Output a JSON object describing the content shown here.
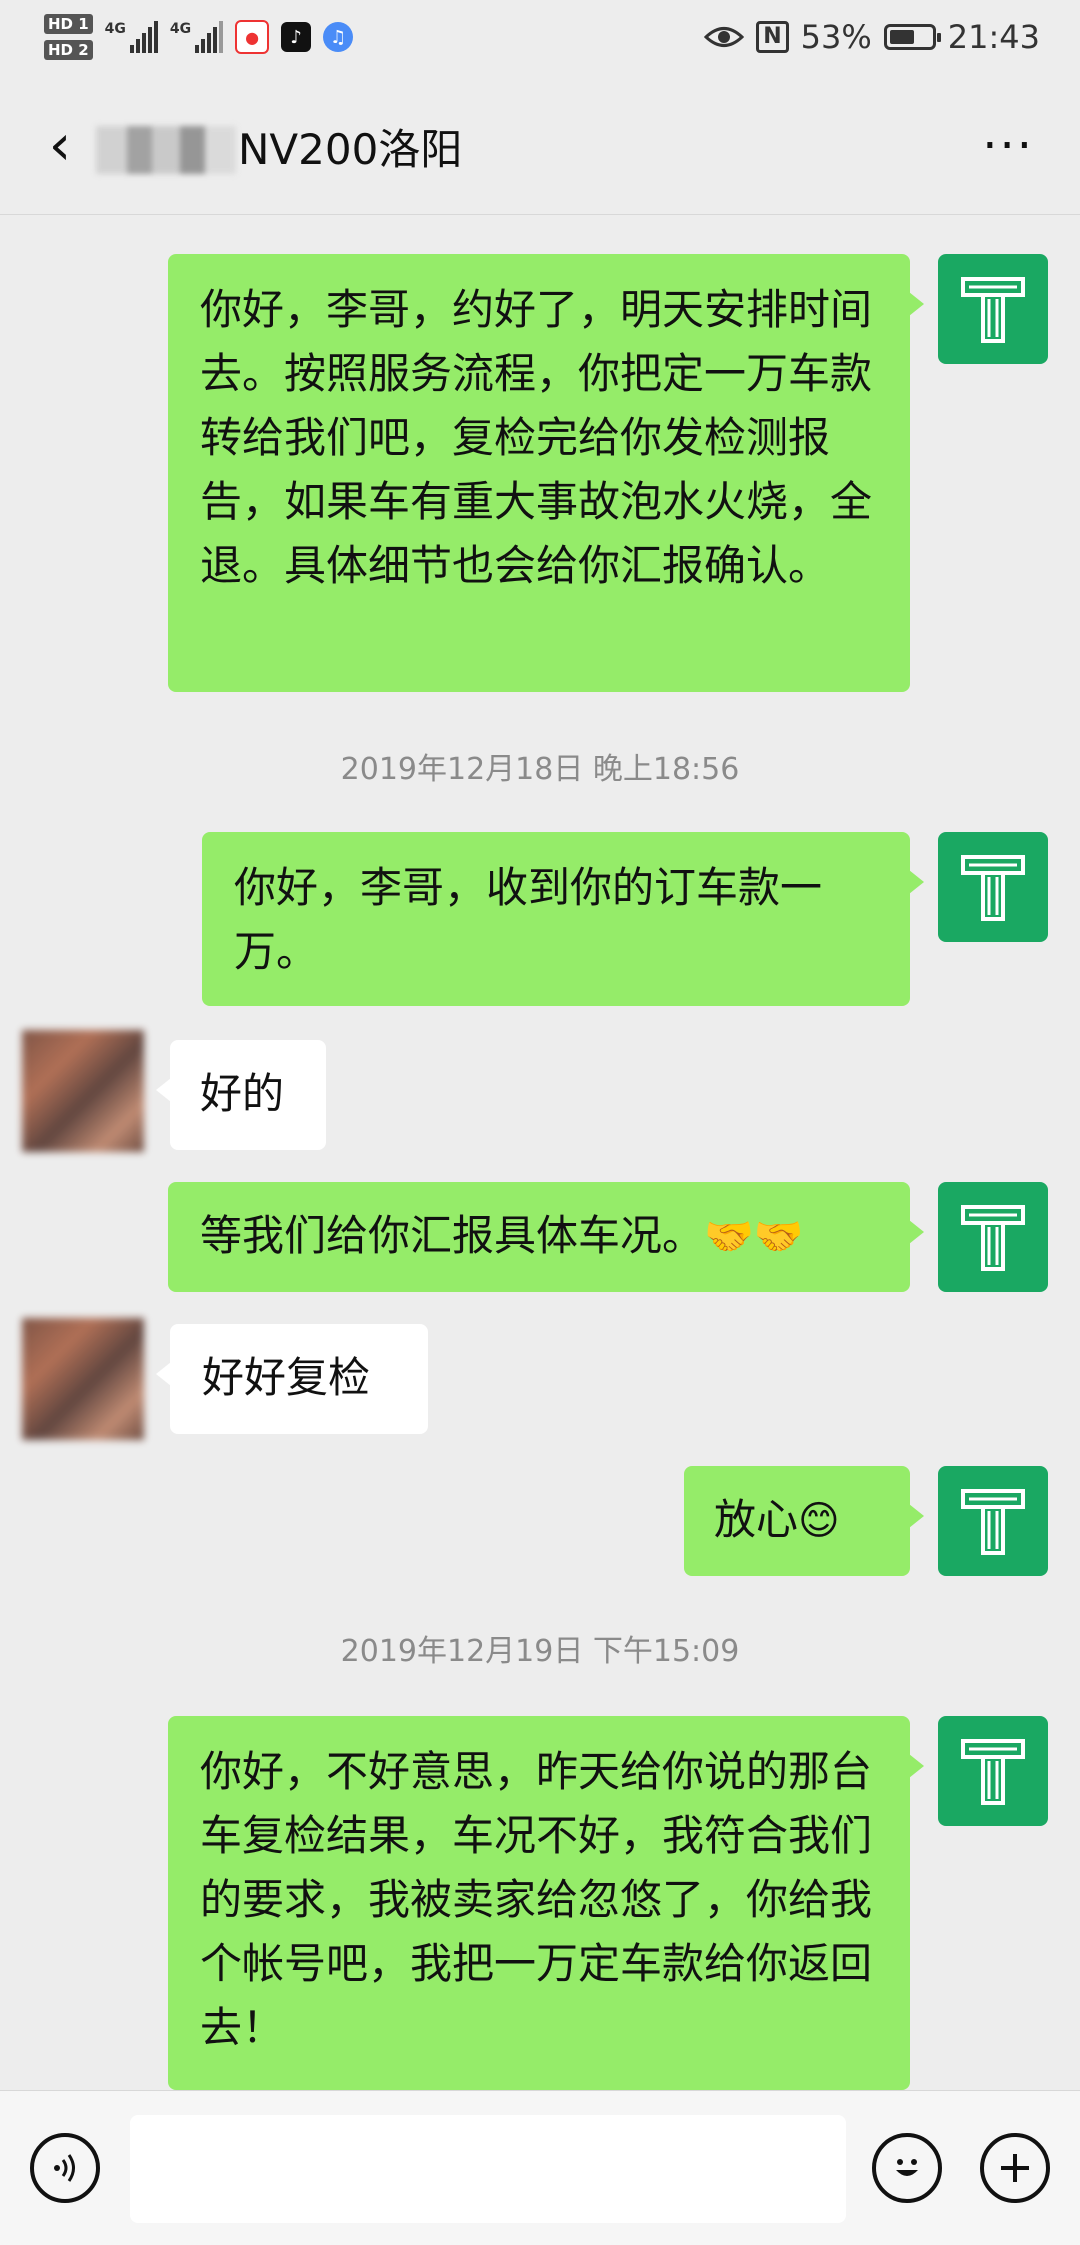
{
  "status_bar": {
    "hd1": "HD 1",
    "hd2": "HD 2",
    "net1": "4G",
    "net2": "4G",
    "nfc": "N",
    "battery_text": "53%",
    "battery_level_percent": 53,
    "time": "21:43"
  },
  "header": {
    "title": "NV200洛阳",
    "back_icon": "back-arrow-icon",
    "more_icon": "more-dots-icon"
  },
  "messages": [
    {
      "side": "out",
      "text": "你好，李哥，约好了，明天安排时间去。按照服务流程，你把定一万车款转给我们吧，复检完给你发检测报告，如果车有重大事故泡水火烧，全退。具体细节也会给你汇报确认。"
    },
    {
      "type": "time",
      "text": "2019年12月18日 晚上18:56"
    },
    {
      "side": "out",
      "text": "你好，李哥，收到你的订车款一万。"
    },
    {
      "side": "in",
      "text": "好的"
    },
    {
      "side": "out",
      "text": "等我们给你汇报具体车况。",
      "emoji": "🤝🤝"
    },
    {
      "side": "in",
      "text": "好好复检"
    },
    {
      "side": "out",
      "text": "放心",
      "emoji": "😊"
    },
    {
      "type": "time",
      "text": "2019年12月19日 下午15:09"
    },
    {
      "side": "out",
      "text": "你好，不好意思，昨天给你说的那台车复检结果，车况不好，我符合我们的要求，我被卖家给忽悠了，你给我个帐号吧，我把一万定车款给你返回去！"
    }
  ],
  "avatar_me_letter": "T",
  "input_bar": {
    "voice_icon": "voice-icon",
    "emoji_icon": "emoji-icon",
    "plus_icon": "plus-icon",
    "text_value": ""
  }
}
